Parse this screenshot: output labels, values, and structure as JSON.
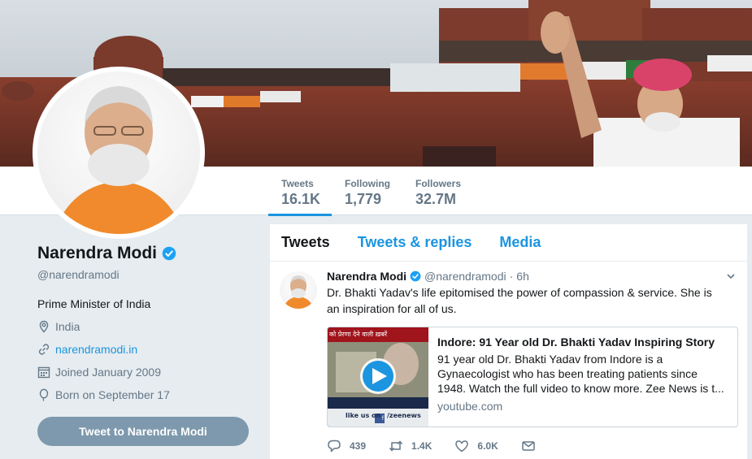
{
  "banner": {
    "description_icon": "banner-image"
  },
  "nav": {
    "stats": [
      {
        "label": "Tweets",
        "value": "16.1K"
      },
      {
        "label": "Following",
        "value": "1,779"
      },
      {
        "label": "Followers",
        "value": "32.7M"
      }
    ]
  },
  "profile": {
    "name": "Narendra Modi",
    "handle": "@narendramodi",
    "bio": "Prime Minister of India",
    "location": "India",
    "website": "narendramodi.in",
    "joined": "Joined January 2009",
    "born": "Born on September 17",
    "tweet_to_label": "Tweet to Narendra Modi"
  },
  "timeline": {
    "tabs": [
      "Tweets",
      "Tweets & replies",
      "Media"
    ],
    "tweet": {
      "name": "Narendra Modi",
      "handle": "@narendramodi",
      "dot": "·",
      "time": "6h",
      "text": "Dr. Bhakti Yadav's life epitomised the power of compassion & service. She is an inspiration for all of us.",
      "card": {
        "title": "Indore: 91 Year old Dr. Bhakti Yadav Inspiring Story",
        "description": "91 year old Dr. Bhakti Yadav from Indore is a Gynaecologist who has been treating patients since 1948. Watch the full video to know more. Zee News is t...",
        "domain": "youtube.com",
        "thumb_top_text": "को प्रेरणा देने वाली ख़बरें",
        "thumb_bottom_text": "like us on",
        "thumb_handle": "/zeenews"
      },
      "actions": {
        "replies": "439",
        "retweets": "1.4K",
        "likes": "6.0K"
      }
    }
  },
  "colors": {
    "accent": "#1b95e0",
    "button": "#7e99ad",
    "background": "#e6ecf0",
    "muted": "#657786"
  }
}
